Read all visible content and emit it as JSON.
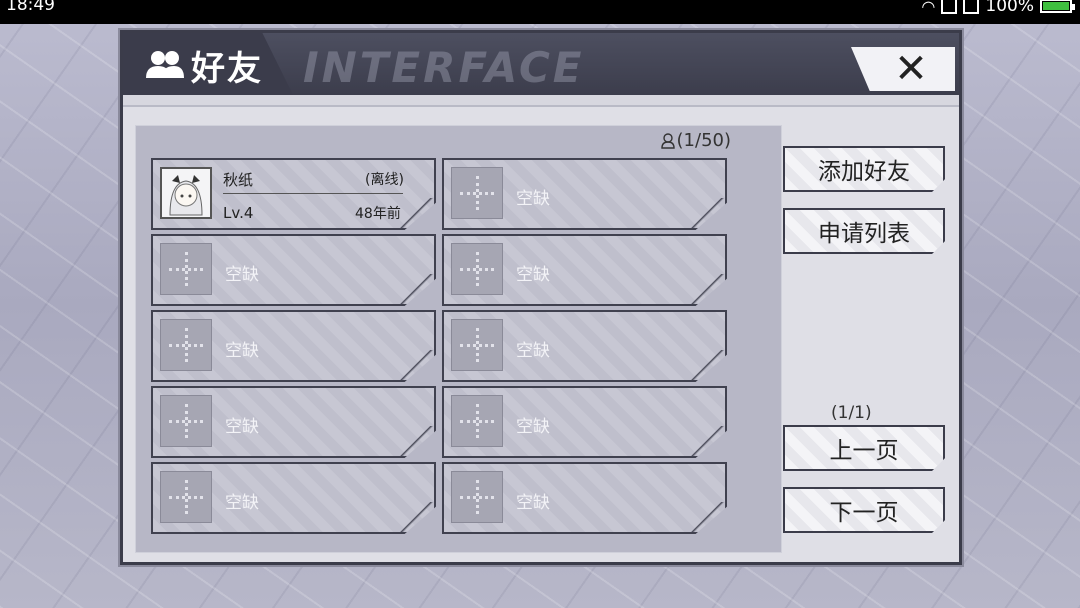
{
  "status_bar": {
    "time": "18:49",
    "battery": "100%",
    "battery_level": 1.0
  },
  "window": {
    "title": "好友",
    "watermark": "INTERFACE",
    "close_label": "✕"
  },
  "friends": {
    "count": "(1/50)",
    "entries": [
      {
        "name": "秋纸",
        "status": "(离线)",
        "level": "Lv.4",
        "last_online": "48年前"
      }
    ],
    "empty_label": "空缺"
  },
  "actions": {
    "add_friend": "添加好友",
    "request_list": "申请列表"
  },
  "pagination": {
    "indicator": "(1/1)",
    "prev": "上一页",
    "next": "下一页"
  }
}
